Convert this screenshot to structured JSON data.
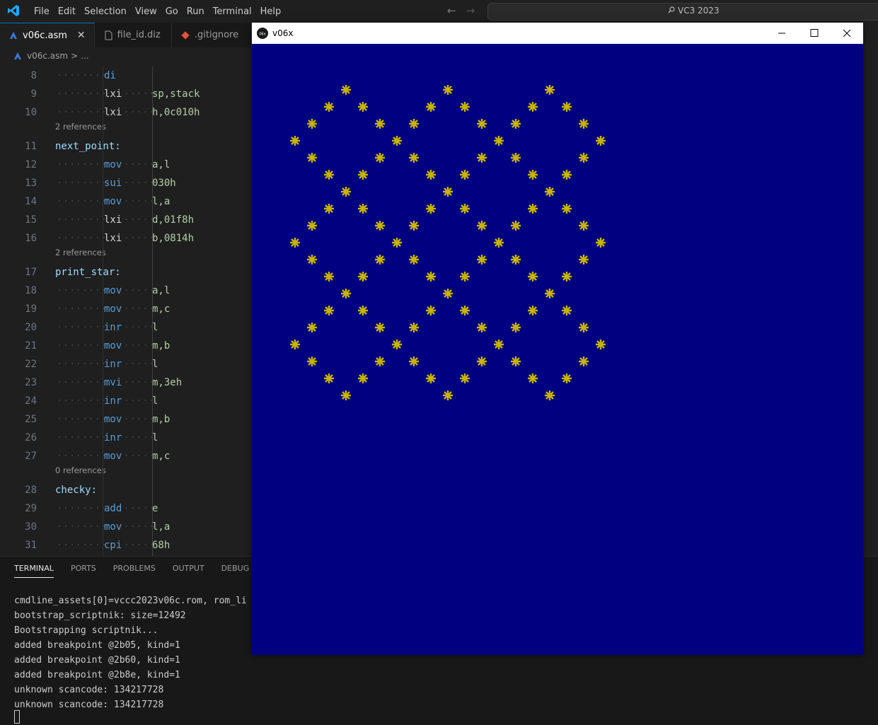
{
  "titlebar": {
    "menu": [
      "File",
      "Edit",
      "Selection",
      "View",
      "Go",
      "Run",
      "Terminal",
      "Help"
    ],
    "search_text": "VC3 2023"
  },
  "tabs": [
    {
      "label": "v06c.asm",
      "active": true
    },
    {
      "label": "file_id.diz",
      "active": false
    },
    {
      "label": ".gitignore",
      "active": false
    }
  ],
  "breadcrumb": {
    "file": "v06c.asm",
    "sep": ">",
    "rest": "..."
  },
  "editor": {
    "lines": [
      {
        "n": "8",
        "op": "di",
        "arg": ""
      },
      {
        "n": "9",
        "op": "lxi",
        "arg": "sp,stack"
      },
      {
        "n": "10",
        "op": "lxi",
        "arg": "h,0c010h"
      },
      {
        "refs": "2 references",
        "n": "11",
        "label": "next_point:"
      },
      {
        "n": "12",
        "op": "mov",
        "arg": "a,l"
      },
      {
        "n": "13",
        "op": "sui",
        "arg": "030h"
      },
      {
        "n": "14",
        "op": "mov",
        "arg": "l,a"
      },
      {
        "n": "15",
        "op": "lxi",
        "arg": "d,01f8h"
      },
      {
        "n": "16",
        "op": "lxi",
        "arg": "b,0814h"
      },
      {
        "refs": "2 references",
        "n": "17",
        "label": "print_star:"
      },
      {
        "n": "18",
        "op": "mov",
        "arg": "a,l"
      },
      {
        "n": "19",
        "op": "mov",
        "arg": "m,c"
      },
      {
        "n": "20",
        "op": "inr",
        "arg": "l"
      },
      {
        "n": "21",
        "op": "mov",
        "arg": "m,b"
      },
      {
        "n": "22",
        "op": "inr",
        "arg": "l"
      },
      {
        "n": "23",
        "op": "mvi",
        "arg": "m,3eh"
      },
      {
        "n": "24",
        "op": "inr",
        "arg": "l"
      },
      {
        "n": "25",
        "op": "mov",
        "arg": "m,b"
      },
      {
        "n": "26",
        "op": "inr",
        "arg": "l"
      },
      {
        "n": "27",
        "op": "mov",
        "arg": "m,c"
      },
      {
        "refs": "0 references",
        "n": "28",
        "label": "checky:"
      },
      {
        "n": "29",
        "op": "add",
        "arg": "e"
      },
      {
        "n": "30",
        "op": "mov",
        "arg": "l,a"
      },
      {
        "n": "31",
        "op": "cpi",
        "arg": "68h"
      }
    ]
  },
  "panel": {
    "tabs": [
      "TERMINAL",
      "PORTS",
      "PROBLEMS",
      "OUTPUT",
      "DEBUG CONS"
    ],
    "terminal_lines": [
      "cmdline_assets[0]=vccc2023v06c.rom, rom_li",
      "bootstrap_scriptnik: size=12492",
      "Bootstrapping scriptnik...",
      "added breakpoint @2b05, kind=1",
      "added breakpoint @2b60, kind=1",
      "added breakpoint @2b8e, kind=1",
      "unknown scancode: 134217728",
      "unknown scancode: 134217728"
    ]
  },
  "emulator": {
    "title": "v06x",
    "screen_color": "#000080",
    "star_color": "#c8b400"
  }
}
